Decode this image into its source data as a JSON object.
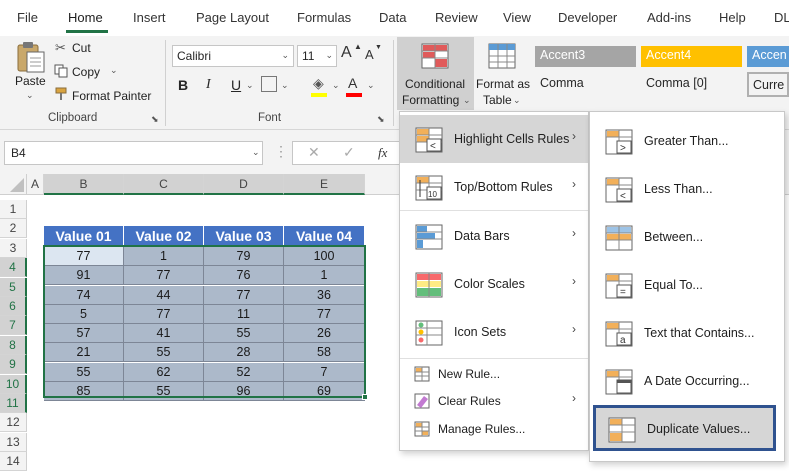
{
  "menu_tabs": [
    "File",
    "Home",
    "Insert",
    "Page Layout",
    "Formulas",
    "Data",
    "Review",
    "View",
    "Developer",
    "Add-ins",
    "Help",
    "DL"
  ],
  "clipboard": {
    "paste": "Paste",
    "cut": "Cut",
    "copy": "Copy",
    "format_painter": "Format Painter",
    "group": "Clipboard"
  },
  "font": {
    "name": "Calibri",
    "size": "11",
    "group": "Font",
    "grow": "A",
    "shrink": "A",
    "bold": "B",
    "italic": "I",
    "underline": "U",
    "font_color_letter": "A"
  },
  "styles": {
    "cond_fmt_line1": "Conditional",
    "cond_fmt_line2": "Formatting",
    "format_table_line1": "Format as",
    "format_table_line2": "Table",
    "accent3": "Accent3",
    "accent4": "Accent4",
    "accent5": "Accen",
    "comma": "Comma",
    "comma0": "Comma [0]",
    "currency": "Curre",
    "accent3_color": "#a5a5a5",
    "accent4_color": "#ffc000",
    "accent5_color": "#5b9bd5"
  },
  "formula_bar": {
    "name_box": "B4",
    "cancel": "✕",
    "enter": "✓",
    "fx": "fx"
  },
  "columns": [
    "A",
    "B",
    "C",
    "D",
    "E"
  ],
  "rows": [
    "1",
    "2",
    "3",
    "4",
    "5",
    "6",
    "7",
    "8",
    "9",
    "10",
    "11",
    "12",
    "13",
    "14"
  ],
  "table": {
    "headers": [
      "Value 01",
      "Value 02",
      "Value 03",
      "Value 04"
    ],
    "rows": [
      [
        "77",
        "1",
        "79",
        "100"
      ],
      [
        "91",
        "77",
        "76",
        "1"
      ],
      [
        "74",
        "44",
        "77",
        "36"
      ],
      [
        "5",
        "77",
        "11",
        "77"
      ],
      [
        "57",
        "41",
        "55",
        "26"
      ],
      [
        "21",
        "55",
        "28",
        "58"
      ],
      [
        "55",
        "62",
        "52",
        "7"
      ],
      [
        "85",
        "55",
        "96",
        "69"
      ]
    ],
    "header_color": "#4472c4",
    "cell_color": "#acb9ca",
    "active_cell_color": "#dce6f1"
  },
  "cf_menu": {
    "items": [
      {
        "label": "Highlight Cells Rules",
        "icon": "highlight-cells-icon"
      },
      {
        "label": "Top/Bottom Rules",
        "icon": "top-bottom-icon"
      },
      {
        "label": "Data Bars",
        "icon": "data-bars-icon"
      },
      {
        "label": "Color Scales",
        "icon": "color-scales-icon"
      },
      {
        "label": "Icon Sets",
        "icon": "icon-sets-icon"
      }
    ],
    "small_items": [
      {
        "label": "New Rule...",
        "icon": "new-rule-icon"
      },
      {
        "label": "Clear Rules",
        "icon": "clear-rules-icon"
      },
      {
        "label": "Manage Rules...",
        "icon": "manage-rules-icon"
      }
    ]
  },
  "sub_menu": {
    "items": [
      {
        "label": "Greater Than...",
        "icon": "greater-than-icon"
      },
      {
        "label": "Less Than...",
        "icon": "less-than-icon"
      },
      {
        "label": "Between...",
        "icon": "between-icon"
      },
      {
        "label": "Equal To...",
        "icon": "equal-to-icon"
      },
      {
        "label": "Text that Contains...",
        "icon": "text-contains-icon"
      },
      {
        "label": "A Date Occurring...",
        "icon": "date-occurring-icon"
      },
      {
        "label": "Duplicate Values...",
        "icon": "duplicate-values-icon"
      }
    ]
  }
}
